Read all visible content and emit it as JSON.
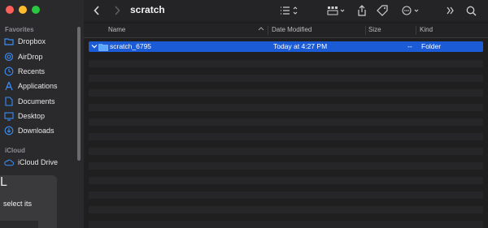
{
  "window": {
    "title": "scratch"
  },
  "sidebar": {
    "favorites_label": "Favorites",
    "items": [
      {
        "label": "Dropbox",
        "icon": "folder-icon"
      },
      {
        "label": "AirDrop",
        "icon": "airdrop-icon"
      },
      {
        "label": "Recents",
        "icon": "clock-icon"
      },
      {
        "label": "Applications",
        "icon": "applications-icon"
      },
      {
        "label": "Documents",
        "icon": "document-icon"
      },
      {
        "label": "Desktop",
        "icon": "desktop-icon"
      },
      {
        "label": "Downloads",
        "icon": "download-icon"
      }
    ],
    "icloud_label": "iCloud",
    "icloud_items": [
      {
        "label": "iCloud Drive",
        "icon": "cloud-icon"
      }
    ]
  },
  "overlay": {
    "text": "select its",
    "tail": "L"
  },
  "columns": {
    "name": "Name",
    "date": "Date Modified",
    "size": "Size",
    "kind": "Kind"
  },
  "rows": [
    {
      "name": "scratch_6795",
      "date": "Today at 4:27 PM",
      "size": "--",
      "kind": "Folder",
      "selected": true
    }
  ],
  "colors": {
    "selection": "#1c5bd6",
    "accent": "#3a8ef6"
  }
}
